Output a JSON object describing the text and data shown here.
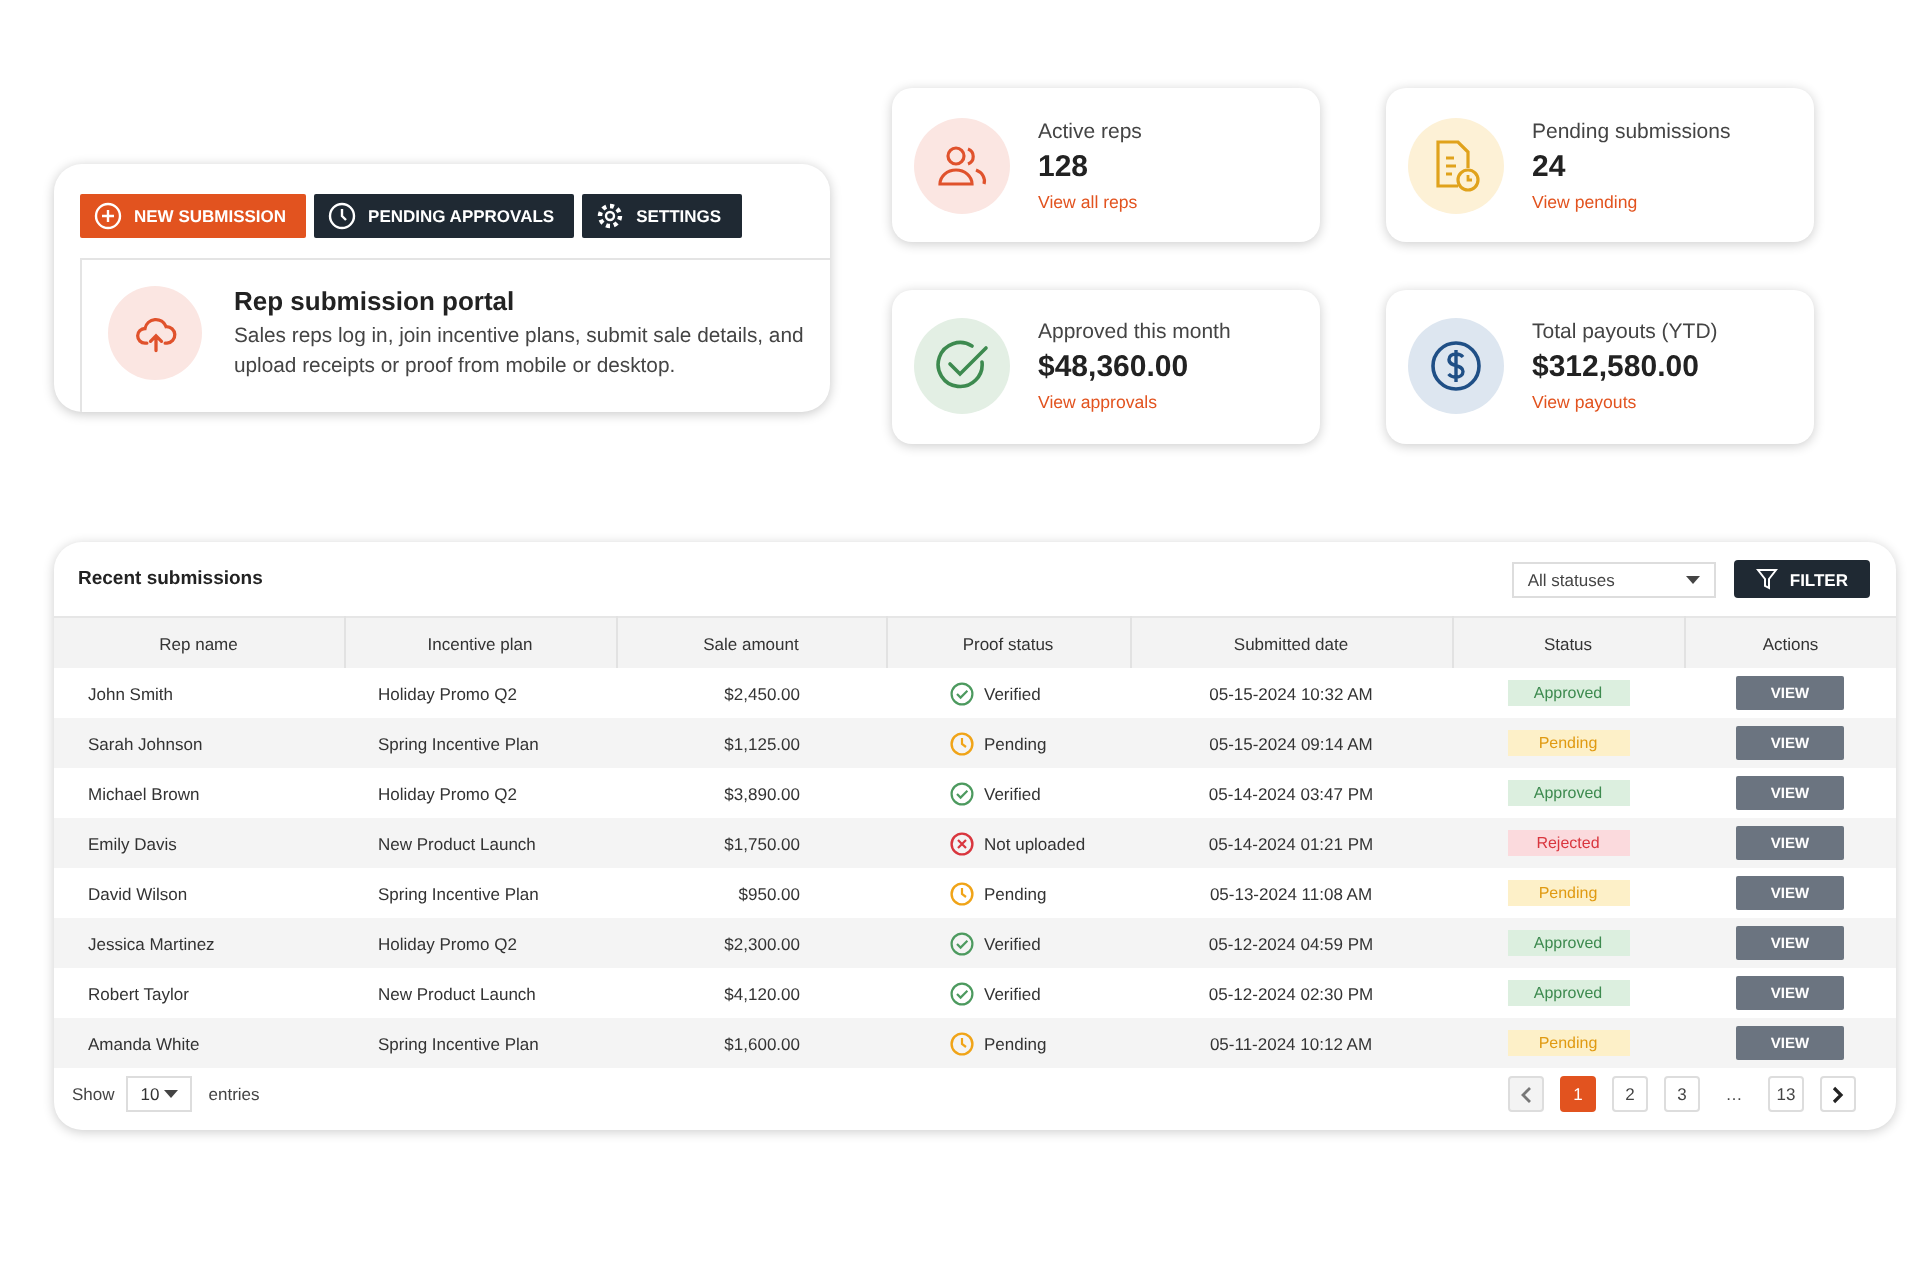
{
  "toolbar": [
    {
      "label": "NEW SUBMISSION",
      "kind": "new",
      "selected": true
    },
    {
      "label": "PENDING APPROVALS",
      "kind": "clock",
      "selected": false
    },
    {
      "label": "SETTINGS",
      "kind": "gear",
      "selected": false
    }
  ],
  "portal": {
    "title": "Rep submission portal",
    "description": "Sales reps log in, join incentive plans, submit sale details, and upload receipts or proof from mobile or desktop."
  },
  "stats": [
    {
      "kind": "reps",
      "label": "Active reps",
      "value": "128",
      "link": "View all reps"
    },
    {
      "kind": "pending",
      "label": "Pending submissions",
      "value": "24",
      "link": "View pending"
    },
    {
      "kind": "approved",
      "label": "Approved this month",
      "value": "$48,360.00",
      "link": "View approvals"
    },
    {
      "kind": "payouts",
      "label": "Total payouts (YTD)",
      "value": "$312,580.00",
      "link": "View payouts"
    }
  ],
  "table": {
    "title": "Recent submissions",
    "status_filter": "All statuses",
    "filter_button": "FILTER",
    "columns": [
      "Rep name",
      "Incentive plan",
      "Sale amount",
      "Proof status",
      "Submitted date",
      "Status",
      "Actions"
    ],
    "rows": [
      {
        "rep": "John Smith",
        "plan": "Holiday Promo Q2",
        "amount": "$2,450.00",
        "proof": {
          "label": "Verified",
          "kind": "verified"
        },
        "date": "05-15-2024 10:32 AM",
        "status": {
          "label": "Approved",
          "kind": "approved"
        },
        "action": "VIEW"
      },
      {
        "rep": "Sarah Johnson",
        "plan": "Spring Incentive Plan",
        "amount": "$1,125.00",
        "proof": {
          "label": "Pending",
          "kind": "pending"
        },
        "date": "05-15-2024 09:14 AM",
        "status": {
          "label": "Pending",
          "kind": "pending"
        },
        "action": "VIEW"
      },
      {
        "rep": "Michael Brown",
        "plan": "Holiday Promo Q2",
        "amount": "$3,890.00",
        "proof": {
          "label": "Verified",
          "kind": "verified"
        },
        "date": "05-14-2024 03:47 PM",
        "status": {
          "label": "Approved",
          "kind": "approved"
        },
        "action": "VIEW"
      },
      {
        "rep": "Emily Davis",
        "plan": "New Product Launch",
        "amount": "$1,750.00",
        "proof": {
          "label": "Not uploaded",
          "kind": "missing"
        },
        "date": "05-14-2024 01:21 PM",
        "status": {
          "label": "Rejected",
          "kind": "rejected"
        },
        "action": "VIEW"
      },
      {
        "rep": "David Wilson",
        "plan": "Spring Incentive Plan",
        "amount": "$950.00",
        "proof": {
          "label": "Pending",
          "kind": "pending"
        },
        "date": "05-13-2024 11:08 AM",
        "status": {
          "label": "Pending",
          "kind": "pending"
        },
        "action": "VIEW"
      },
      {
        "rep": "Jessica Martinez",
        "plan": "Holiday Promo Q2",
        "amount": "$2,300.00",
        "proof": {
          "label": "Verified",
          "kind": "verified"
        },
        "date": "05-12-2024 04:59 PM",
        "status": {
          "label": "Approved",
          "kind": "approved"
        },
        "action": "VIEW"
      },
      {
        "rep": "Robert Taylor",
        "plan": "New Product Launch",
        "amount": "$4,120.00",
        "proof": {
          "label": "Verified",
          "kind": "verified"
        },
        "date": "05-12-2024 02:30 PM",
        "status": {
          "label": "Approved",
          "kind": "approved"
        },
        "action": "VIEW"
      },
      {
        "rep": "Amanda White",
        "plan": "Spring Incentive Plan",
        "amount": "$1,600.00",
        "proof": {
          "label": "Pending",
          "kind": "pending"
        },
        "date": "05-11-2024 10:12 AM",
        "status": {
          "label": "Pending",
          "kind": "pending"
        },
        "action": "VIEW"
      }
    ],
    "show_label": "Show",
    "page_size": "10",
    "entries_label": "entries",
    "pages": [
      {
        "label": "1",
        "kind": "page",
        "selected": true
      },
      {
        "label": "2",
        "kind": "page",
        "selected": false
      },
      {
        "label": "3",
        "kind": "page",
        "selected": false
      },
      {
        "label": "…",
        "kind": "gap"
      },
      {
        "label": "13",
        "kind": "page",
        "selected": false
      }
    ]
  }
}
